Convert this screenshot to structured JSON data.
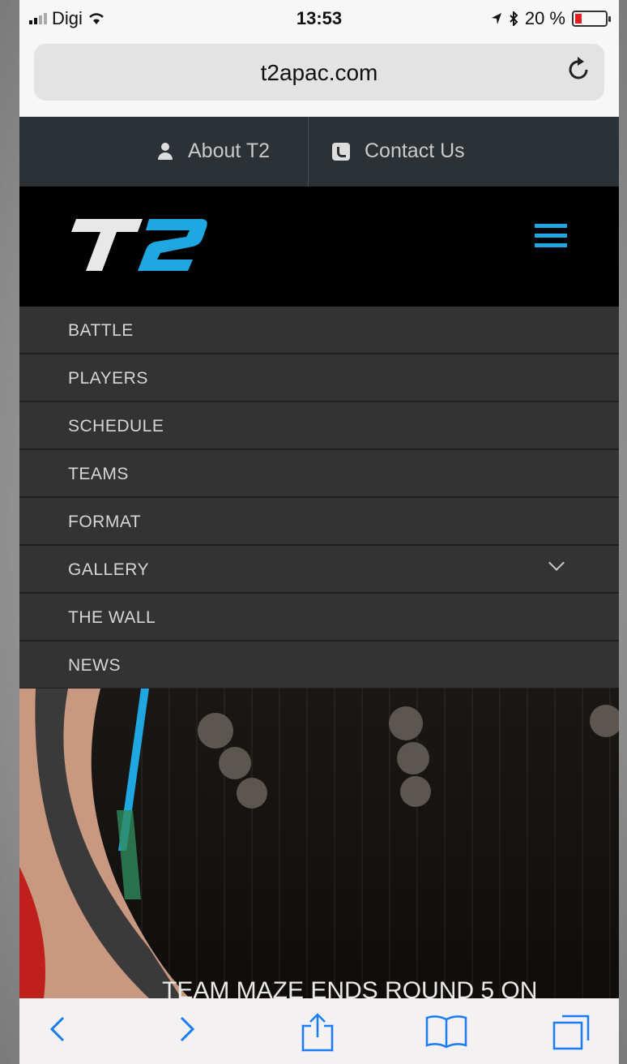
{
  "status_bar": {
    "carrier": "Digi",
    "time": "13:53",
    "battery": "20 %"
  },
  "browser": {
    "url": "t2apac.com"
  },
  "topbar": {
    "about": "About T2",
    "contact": "Contact Us"
  },
  "site": {
    "logo_text": "T2"
  },
  "nav": {
    "items": [
      {
        "label": "BATTLE"
      },
      {
        "label": "PLAYERS"
      },
      {
        "label": "SCHEDULE"
      },
      {
        "label": "TEAMS"
      },
      {
        "label": "FORMAT"
      },
      {
        "label": "GALLERY"
      },
      {
        "label": "THE WALL"
      },
      {
        "label": "NEWS"
      }
    ]
  },
  "hero": {
    "headline": "TEAM MAZE ENDS ROUND 5 ON"
  },
  "colors": {
    "accent": "#1ea7e1",
    "nav_bg": "#333333",
    "topbar_bg": "#2c3135",
    "ios_blue": "#1a7cf2"
  }
}
